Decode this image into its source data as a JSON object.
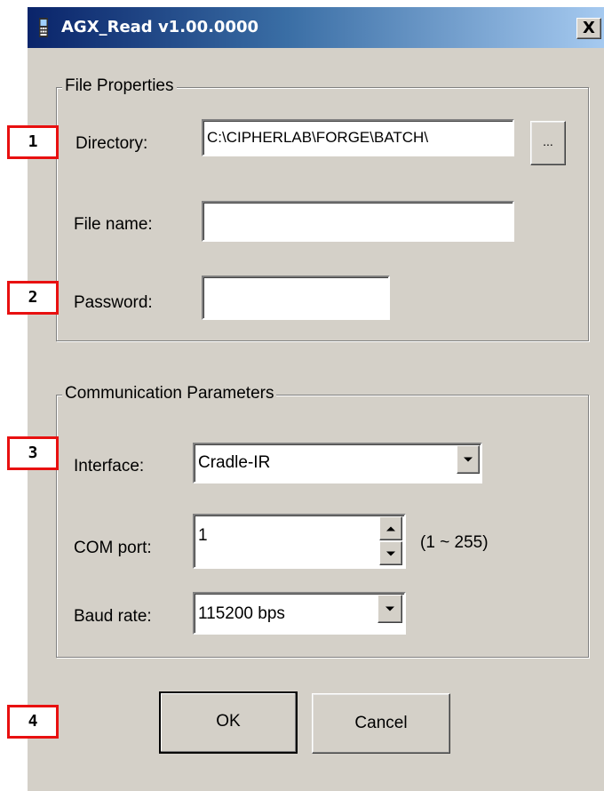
{
  "window": {
    "title": "AGX_Read v1.00.0000",
    "close_glyph": "X",
    "icon": "handheld-terminal-icon"
  },
  "file_properties": {
    "legend": "File Properties",
    "directory_label": "Directory:",
    "directory_value": "C:\\CIPHERLAB\\FORGE\\BATCH\\",
    "browse_label": "...",
    "filename_label": "File name:",
    "filename_value": "",
    "password_label": "Password:",
    "password_value": ""
  },
  "communication": {
    "legend": "Communication Parameters",
    "interface_label": "Interface:",
    "interface_value": "Cradle-IR",
    "com_port_label": "COM port:",
    "com_port_value": "1",
    "com_port_range": "(1 ~ 255)",
    "baud_rate_label": "Baud rate:",
    "baud_rate_value": "115200 bps"
  },
  "buttons": {
    "ok": "OK",
    "cancel": "Cancel"
  },
  "callouts": [
    "1",
    "2",
    "3",
    "4"
  ],
  "colors": {
    "callout_border": "#e81010",
    "titlebar_start": "#0a246a",
    "dialog_bg": "#d4d0c8"
  }
}
